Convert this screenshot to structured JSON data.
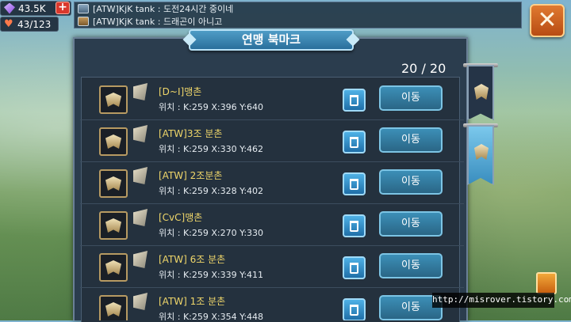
{
  "resources": {
    "gems": "43.5K",
    "hp": "43/123"
  },
  "chat": [
    {
      "sender": "[ATW]KjK tank",
      "message": "도전24시간 중이네"
    },
    {
      "sender": "[ATW]KjK tank",
      "message": "드래곤이 아니고"
    }
  ],
  "panel": {
    "title": "연맹 북마크",
    "counter": "20 / 20"
  },
  "bookmarks": [
    {
      "name": "[D~I]맹촌",
      "position": "위치 : K:259 X:396 Y:640",
      "move_label": "이동"
    },
    {
      "name": "[ATW]3조 분촌",
      "position": "위치 : K:259 X:330 Y:462",
      "move_label": "이동"
    },
    {
      "name": "[ATW] 2조분촌",
      "position": "위치 : K:259 X:328 Y:402",
      "move_label": "이동"
    },
    {
      "name": "[CvC]맹촌",
      "position": "위치 : K:259 X:270 Y:330",
      "move_label": "이동"
    },
    {
      "name": "[ATW] 6조 분촌",
      "position": "위치 : K:259 X:339 Y:411",
      "move_label": "이동"
    },
    {
      "name": "[ATW] 1조 분촌",
      "position": "위치 : K:259 X:354 Y:448",
      "move_label": "이동"
    }
  ],
  "watermark": "http://misrover.tistory.com",
  "icons": {
    "gems": "gem-icon",
    "hp": "heart-icon",
    "add": "plus-icon",
    "close": "close-icon",
    "trash": "trash-icon",
    "emblem": "guild-emblem-icon",
    "flag": "flag-icon"
  }
}
